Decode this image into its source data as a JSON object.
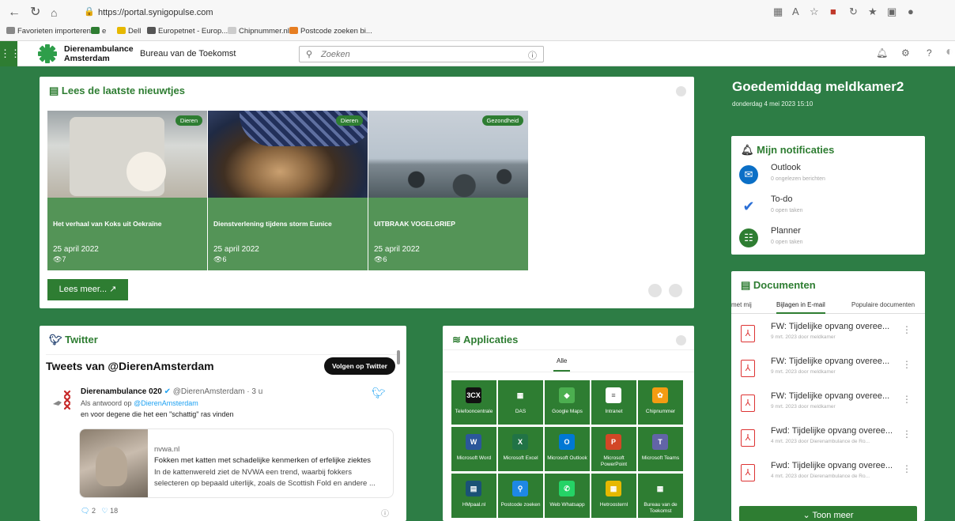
{
  "browser": {
    "url": "https://portal.synigopulse.com",
    "bookmarks": [
      {
        "label": "Favorieten importeren",
        "color": "#888888"
      },
      {
        "label": "e",
        "color": "#2e7d32"
      },
      {
        "label": "Dell",
        "color": "#e6b800"
      },
      {
        "label": "Europetnet - Europ...",
        "color": "#555555"
      },
      {
        "label": "Chipnummer.nl",
        "color": "#777777"
      },
      {
        "label": "Postcode zoeken bi...",
        "color": "#e67e22"
      }
    ]
  },
  "appbar": {
    "brand_line1": "Dierenambulance",
    "brand_line2": "Amsterdam",
    "section": "Bureau van de Toekomst",
    "search_placeholder": "Zoeken"
  },
  "news": {
    "title": "Lees de laatste nieuwtjes",
    "more_label": "Lees meer...",
    "items": [
      {
        "badge": "Dieren",
        "title": "Het verhaal van Koks uit Oekraïne",
        "date": "25 april 2022",
        "views": "7"
      },
      {
        "badge": "Dieren",
        "title": "Dienstverlening tijdens storm Eunice",
        "date": "25 april 2022",
        "views": "6"
      },
      {
        "badge": "Gezondheid",
        "title": "UITBRAAK VOGELGRIEP",
        "date": "25 april 2022",
        "views": "6"
      }
    ]
  },
  "greeting": {
    "title": "Goedemiddag meldkamer2",
    "date": "donderdag 4 mei 2023 15:10"
  },
  "notifications": {
    "title": "Mijn notificaties",
    "items": [
      {
        "name": "Outlook",
        "sub": "0 ongelezen berichten",
        "color": "#0b6fc6"
      },
      {
        "name": "To-do",
        "sub": "0 open taken",
        "color": "#2b6fd6"
      },
      {
        "name": "Planner",
        "sub": "0 open taken",
        "color": "#2e7d32"
      }
    ]
  },
  "documents": {
    "title": "Documenten",
    "tabs": [
      "met mij",
      "Bijlagen in E-mail",
      "Populaire documenten"
    ],
    "items": [
      {
        "name": "FW: Tijdelijke opvang overee...",
        "sub": "9 mrt. 2023 door meldkamer"
      },
      {
        "name": "FW: Tijdelijke opvang overee...",
        "sub": "9 mrt. 2023 door meldkamer"
      },
      {
        "name": "FW: Tijdelijke opvang overee...",
        "sub": "9 mrt. 2023 door meldkamer"
      },
      {
        "name": "Fwd: Tijdelijke opvang overee...",
        "sub": "4 mrt. 2023 door Dierenambulance de Ro..."
      },
      {
        "name": "Fwd: Tijdelijke opvang overee...",
        "sub": "4 mrt. 2023 door Dierenambulance de Ro..."
      }
    ],
    "more_label": "Toon meer"
  },
  "twitter": {
    "title": "Twitter",
    "header": "Tweets van @DierenAmsterdam",
    "follow_label": "Volgen op Twitter",
    "tweet": {
      "author": "Dierenambulance 020",
      "handle": "@DierenAmsterdam · 3 u",
      "reply_prefix": "Als antwoord op",
      "reply_to": "@DierenAmsterdam",
      "text": "en voor degene die het een \"schattig\" ras vinden",
      "link_domain": "nvwa.nl",
      "link_title": "Fokken met katten met schadelijke kenmerken of erfelijke ziektes",
      "link_desc1": "In de kattenwereld ziet de NVWA een trend, waarbij fokkers",
      "link_desc2": "selecteren op bepaald uiterlijk, zoals de Scottish Fold en andere ...",
      "replies": "2",
      "likes": "18"
    }
  },
  "applications": {
    "title": "Applicaties",
    "filter": "Alle",
    "items": [
      {
        "label": "Telefooncentrale",
        "icon": "3CX",
        "color": "#111111"
      },
      {
        "label": "DAS",
        "icon": "▦",
        "color": "#2e7d32"
      },
      {
        "label": "Google Maps",
        "icon": "◆",
        "color": "#4caf50"
      },
      {
        "label": "Intranet",
        "icon": "≡",
        "color": "#ffffff"
      },
      {
        "label": "Chipnummer",
        "icon": "✿",
        "color": "#f39c12"
      },
      {
        "label": "Microsoft Word",
        "icon": "W",
        "color": "#2b579a"
      },
      {
        "label": "Microsoft Excel",
        "icon": "X",
        "color": "#217346"
      },
      {
        "label": "Microsoft Outlook",
        "icon": "O",
        "color": "#0078d4"
      },
      {
        "label": "Microsoft PowerPoint",
        "icon": "P",
        "color": "#d24726"
      },
      {
        "label": "Microsoft Teams",
        "icon": "T",
        "color": "#6264a7"
      },
      {
        "label": "HMpaal.nl",
        "icon": "▤",
        "color": "#1a5276"
      },
      {
        "label": "Postcode zoeken",
        "icon": "⚲",
        "color": "#1e88e5"
      },
      {
        "label": "Web Whatsapp",
        "icon": "✆",
        "color": "#25d366"
      },
      {
        "label": "Hetroosternl",
        "icon": "▦",
        "color": "#e6b800"
      },
      {
        "label": "Bureau van de Toekomst",
        "icon": "▦",
        "color": "#2e7d32"
      }
    ]
  }
}
